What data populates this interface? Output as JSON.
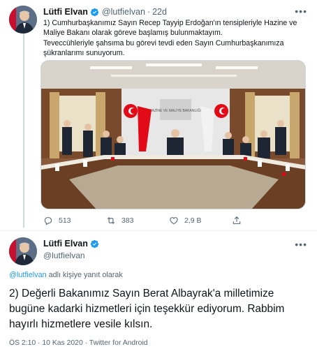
{
  "colors": {
    "accent": "#1d9bf0",
    "text_primary": "#0f1419",
    "text_secondary": "#536471",
    "divider": "#eff3f4",
    "flag_red": "#e30a17"
  },
  "tweet1": {
    "author_name": "Lütfi Elvan",
    "handle": "@lutfielvan",
    "separator": "·",
    "time": "22d",
    "more_icon": "more-horizontal-icon",
    "lines": [
      "1) Cumhurbaşkanımız Sayın Recep Tayyip Erdoğan'ın tensipleriyle Hazine ve Maliye Bakanı olarak göreve başlamış bulunmaktayım.",
      "Teveccühleriyle şahsıma bu görevi tevdi eden Sayın Cumhurbaşkanımıza şükranlarımı sunuyorum."
    ],
    "photo_sign": "HAZİNE VE MALİYE BAKANLIĞI",
    "actions": {
      "reply_count": "513",
      "retweet_count": "383",
      "like_count": "2,9 B",
      "share_label": ""
    }
  },
  "tweet2": {
    "author_name": "Lütfi Elvan",
    "handle": "@lutfielvan",
    "replying_to_handle": "@lutfielvan",
    "replying_to_suffix": " adlı kişiye yanıt olarak",
    "text": "2) Değerli Bakanımız Sayın Berat Albayrak'a milletimize bugüne kadarki hizmetleri için teşekkür ediyorum. Rabbim hayırlı hizmetlere vesile kılsın.",
    "time": "ÖS 2:10",
    "separator": "·",
    "date": "10 Kas 2020",
    "source": "Twitter for Android"
  }
}
